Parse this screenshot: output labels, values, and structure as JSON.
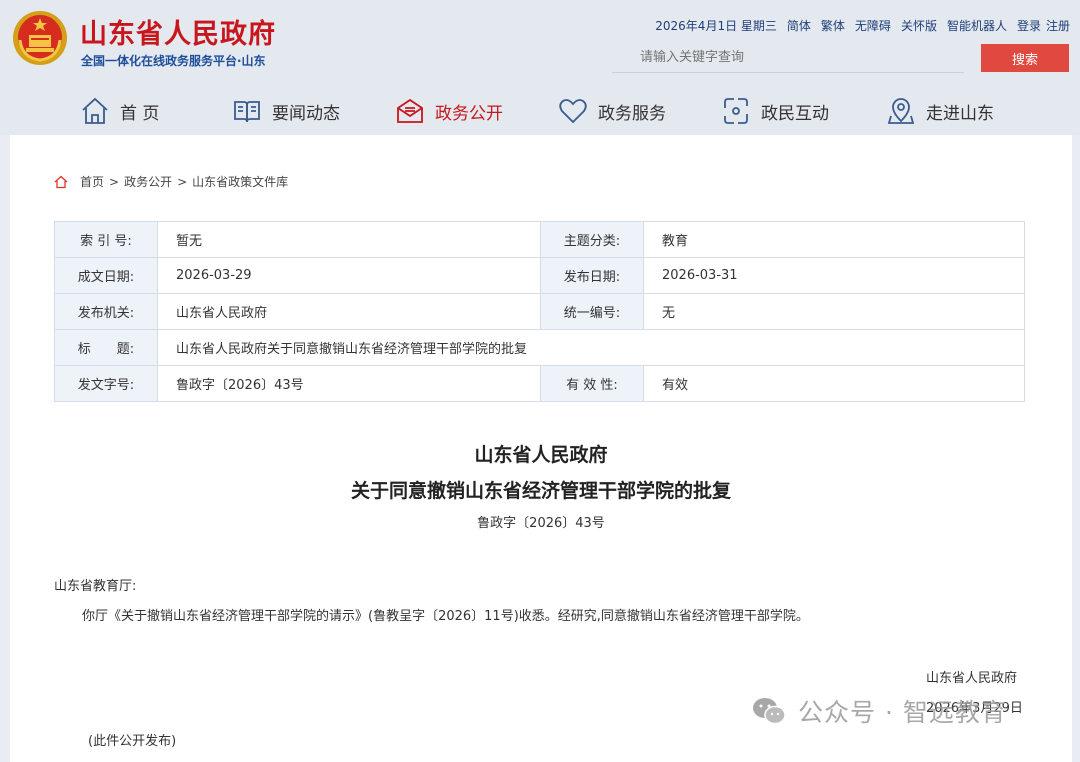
{
  "header": {
    "title": "山东省人民政府",
    "subtitle": "全国一体化在线政务服务平台·山东",
    "top_links": [
      "2026年4月1日 星期三",
      "简体",
      "繁体",
      "无障碍",
      "关怀版",
      "智能机器人",
      "登录",
      "注册"
    ],
    "search_placeholder": "请输入关键字查询",
    "search_button": "搜索"
  },
  "nav": {
    "items": [
      {
        "label": "首 页",
        "icon": "home-icon"
      },
      {
        "label": "要闻动态",
        "icon": "book-icon"
      },
      {
        "label": "政务公开",
        "icon": "mail-open-icon",
        "active": true
      },
      {
        "label": "政务服务",
        "icon": "heart-icon"
      },
      {
        "label": "政民互动",
        "icon": "interaction-icon"
      },
      {
        "label": "走进山东",
        "icon": "map-pin-icon"
      }
    ],
    "active_color": "#c8161d"
  },
  "breadcrumb": [
    "首页",
    "政务公开",
    "山东省政策文件库"
  ],
  "meta": {
    "index_label": "索 引 号:",
    "index_value": "暂无",
    "topic_label": "主题分类:",
    "topic_value": "教育",
    "written_label": "成文日期:",
    "written_value": "2026-03-29",
    "publish_label": "发布日期:",
    "publish_value": "2026-03-31",
    "org_label": "发布机关:",
    "org_value": "山东省人民政府",
    "code_label": "统一编号:",
    "code_value": "无",
    "title_label": "标　　题:",
    "title_value": "山东省人民政府关于同意撤销山东省经济管理干部学院的批复",
    "docno_label": "发文字号:",
    "docno_value": "鲁政字〔2026〕43号",
    "validity_label": "有 效 性:",
    "validity_value": "有效"
  },
  "document": {
    "title_line1": "山东省人民政府",
    "title_line2": "关于同意撤销山东省经济管理干部学院的批复",
    "number": "鲁政字〔2026〕43号",
    "addressee": "山东省教育厅:",
    "body": "你厅《关于撤销山东省经济管理干部学院的请示》(鲁教呈字〔2026〕11号)收悉。经研究,同意撤销山东省经济管理干部学院。",
    "signature_org": "山东省人民政府",
    "signature_date": "2026年3月29日",
    "public_note": "(此件公开发布)"
  },
  "watermark": "公众号 · 智远教育"
}
